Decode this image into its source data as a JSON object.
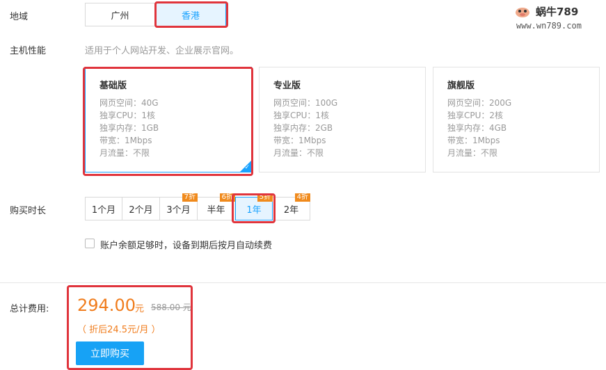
{
  "region": {
    "label": "地域",
    "options": [
      "广州",
      "香港"
    ],
    "selected": "香港"
  },
  "performance": {
    "label": "主机性能",
    "description": "适用于个人网站开发、企业展示官网。",
    "plans": [
      {
        "name": "基础版",
        "specs": [
          "网页空间：40G",
          "独享CPU：1核",
          "独享内存：1GB",
          "带宽：1Mbps",
          "月流量：不限"
        ]
      },
      {
        "name": "专业版",
        "specs": [
          "网页空间：100G",
          "独享CPU：1核",
          "独享内存：2GB",
          "带宽：1Mbps",
          "月流量：不限"
        ]
      },
      {
        "name": "旗舰版",
        "specs": [
          "网页空间：200G",
          "独享CPU：2核",
          "独享内存：4GB",
          "带宽：1Mbps",
          "月流量：不限"
        ]
      }
    ],
    "selected": "基础版"
  },
  "duration": {
    "label": "购买时长",
    "options": [
      {
        "label": "1个月",
        "badge": ""
      },
      {
        "label": "2个月",
        "badge": ""
      },
      {
        "label": "3个月",
        "badge": "7折"
      },
      {
        "label": "半年",
        "badge": "6折"
      },
      {
        "label": "1年",
        "badge": "5折"
      },
      {
        "label": "2年",
        "badge": "4折"
      }
    ],
    "selected": "1年"
  },
  "auto_renew": {
    "label": "账户余额足够时，设备到期后按月自动续费",
    "checked": false
  },
  "total": {
    "label": "总计费用:",
    "price": "294.00",
    "unit": "元",
    "original": "588.00 元",
    "per_month": "（ 折后24.5元/月 ）",
    "buy_label": "立即购买"
  },
  "watermark": {
    "title": "蜗牛789",
    "url": "www.wn789.com"
  },
  "colors": {
    "accent": "#1aa3ff",
    "price": "#f07c1c",
    "badge": "#f08a1c",
    "highlight": "#e0343c",
    "button": "#17a2f5"
  }
}
